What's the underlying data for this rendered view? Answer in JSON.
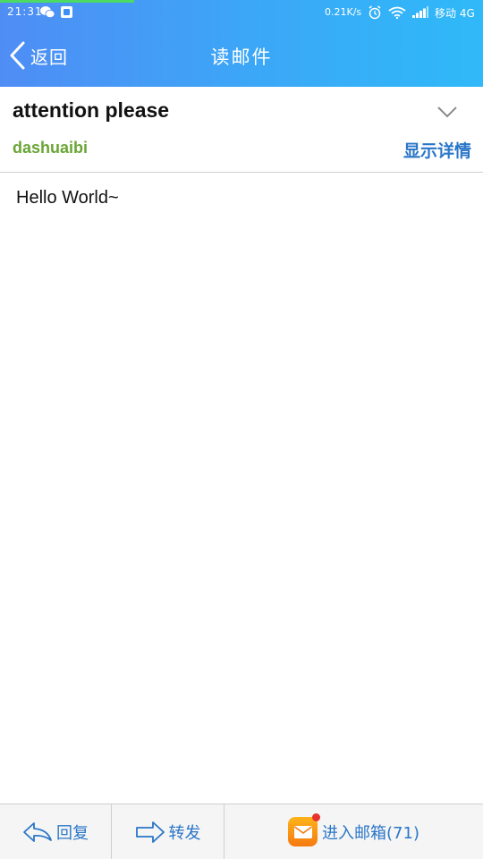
{
  "status_bar": {
    "time": "21:31",
    "net_speed": "0.21K/s",
    "carrier": "移动 4G"
  },
  "nav": {
    "back_label": "返回",
    "title": "读邮件"
  },
  "email": {
    "subject": "attention please",
    "sender": "dashuaibi",
    "show_details_label": "显示详情",
    "body": "Hello World~"
  },
  "bottom_bar": {
    "reply_label": "回复",
    "forward_label": "转发",
    "mailbox_label": "进入邮箱(71)"
  },
  "colors": {
    "header_start": "#4f8df5",
    "header_end": "#2fb9f8",
    "link_blue": "#2a76c8",
    "sender_green": "#6aa535"
  }
}
